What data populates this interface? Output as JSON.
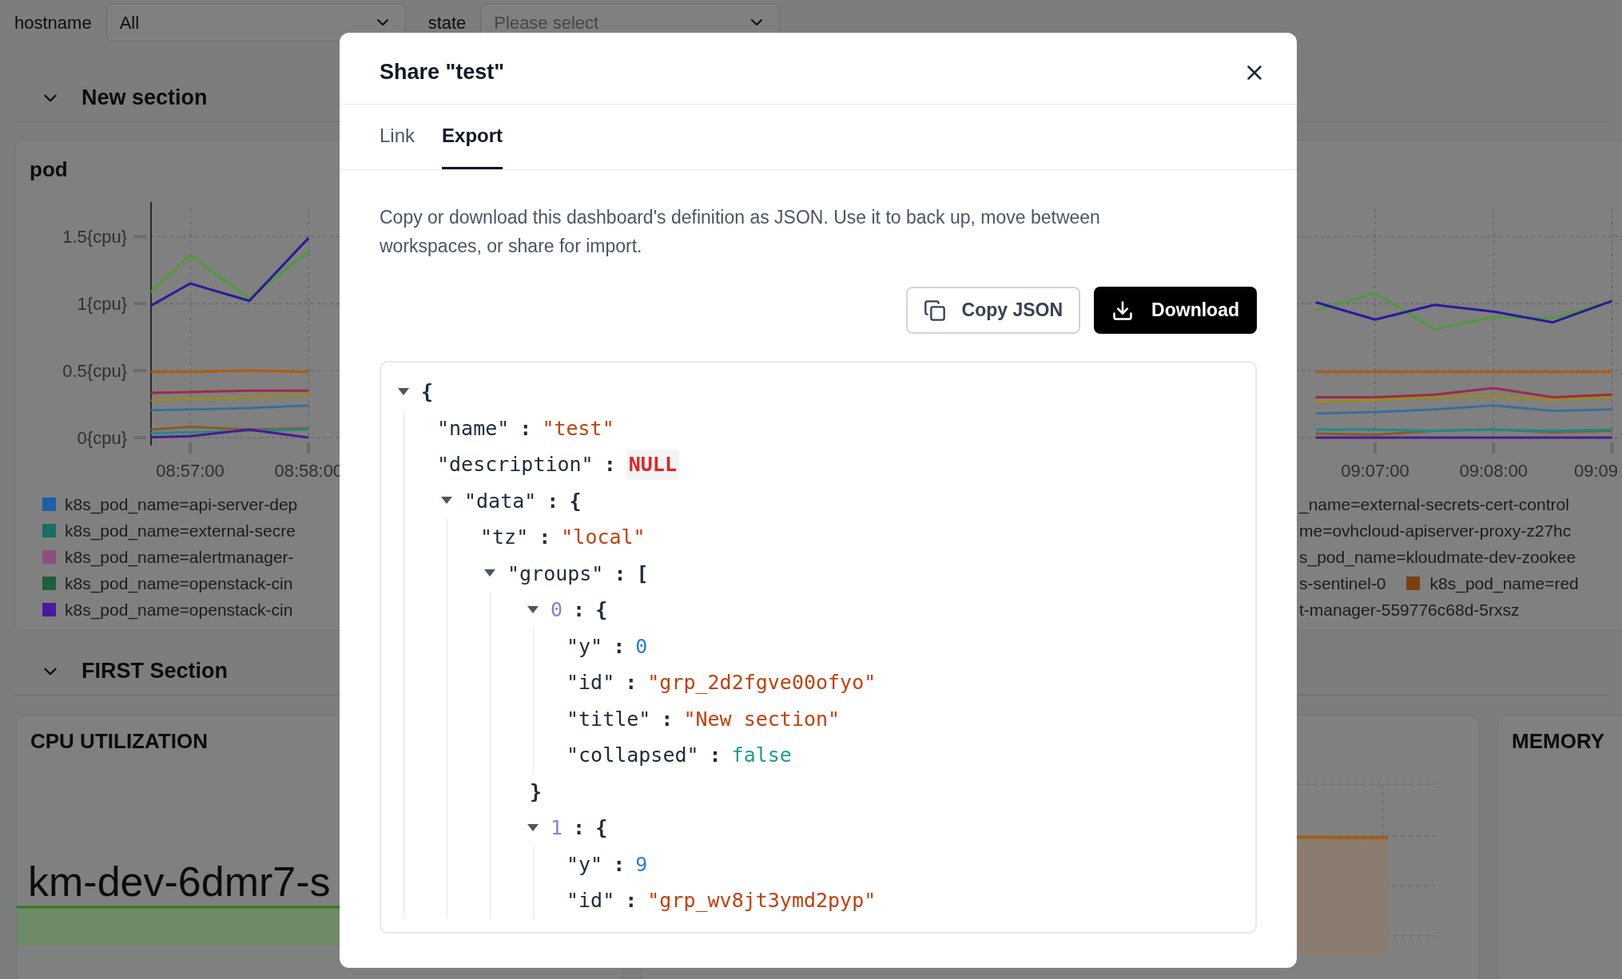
{
  "filters": [
    {
      "label": "hostname",
      "value": "All"
    },
    {
      "label": "state",
      "placeholder": "Please select"
    }
  ],
  "sections": [
    {
      "title": "New section",
      "expanded": true,
      "panels": [
        {
          "kind": "timeseries",
          "title": "pod",
          "chart_data": {
            "type": "line",
            "grid": true,
            "ylim": [
              0,
              1.71
            ],
            "categories": [
              null,
              "08:57:00",
              null,
              "08:58:00",
              null,
              null,
              null,
              null,
              null,
              null,
              null,
              null,
              null,
              null,
              null,
              null,
              null,
              null,
              null,
              null,
              null,
              "09:07:00",
              null,
              "09:08:00",
              null,
              "09:09"
            ],
            "yticks": [
              {
                "value": 0,
                "label": "0{cpu}"
              },
              {
                "value": 0.5,
                "label": "0.5{cpu}"
              },
              {
                "value": 1,
                "label": "1{cpu}"
              },
              {
                "value": 1.5,
                "label": "1.5{cpu}"
              }
            ],
            "series": [
              {
                "color": "#4f9a3b",
                "values": [
                  0.95,
                  1.36,
                  1.04,
                  1.39,
                  null,
                  null,
                  null,
                  null,
                  null,
                  null,
                  null,
                  null,
                  null,
                  null,
                  null,
                  null,
                  null,
                  null,
                  null,
                  null,
                  0.95,
                  1.08,
                  0.81,
                  0.9,
                  0.89,
                  1.02
                ]
              },
              {
                "color": "#2b1a9a",
                "values": [
                  0.9,
                  1.15,
                  1.02,
                  1.49,
                  null,
                  null,
                  null,
                  null,
                  null,
                  null,
                  null,
                  null,
                  null,
                  null,
                  null,
                  null,
                  null,
                  null,
                  null,
                  null,
                  1.01,
                  0.88,
                  0.99,
                  0.94,
                  0.86,
                  1.02
                ]
              },
              {
                "color": "#b05a10",
                "values": [
                  0.49,
                  0.49,
                  0.5,
                  0.49,
                  null,
                  null,
                  null,
                  null,
                  null,
                  null,
                  null,
                  null,
                  null,
                  null,
                  null,
                  null,
                  null,
                  null,
                  null,
                  null,
                  0.49,
                  0.49,
                  0.49,
                  0.49,
                  0.49,
                  0.49
                ]
              },
              {
                "color": "#a02a48",
                "values": [
                  0.33,
                  0.34,
                  0.35,
                  0.35,
                  null,
                  null,
                  null,
                  null,
                  null,
                  null,
                  null,
                  null,
                  null,
                  null,
                  null,
                  null,
                  null,
                  null,
                  null,
                  null,
                  0.3,
                  0.3,
                  0.32,
                  0.37,
                  0.3,
                  0.32
                ]
              },
              {
                "color": "#9a8a20",
                "values": [
                  0.27,
                  0.29,
                  0.3,
                  0.32,
                  null,
                  null,
                  null,
                  null,
                  null,
                  null,
                  null,
                  null,
                  null,
                  null,
                  null,
                  null,
                  null,
                  null,
                  null,
                  null,
                  0.27,
                  0.28,
                  0.3,
                  0.31,
                  0.28,
                  0.3
                ]
              },
              {
                "color": "#3a6e9a",
                "values": [
                  0.2,
                  0.21,
                  0.22,
                  0.24,
                  null,
                  null,
                  null,
                  null,
                  null,
                  null,
                  null,
                  null,
                  null,
                  null,
                  null,
                  null,
                  null,
                  null,
                  null,
                  null,
                  0.18,
                  0.19,
                  0.21,
                  0.24,
                  0.2,
                  0.21
                ]
              },
              {
                "color": "#8a5a28",
                "values": [
                  0.05,
                  0.08,
                  0.06,
                  0.07,
                  null,
                  null,
                  null,
                  null,
                  null,
                  null,
                  null,
                  null,
                  null,
                  null,
                  null,
                  null,
                  null,
                  null,
                  null,
                  null,
                  0.03,
                  0.02,
                  0.05,
                  0.06,
                  0.04,
                  0.05
                ]
              },
              {
                "color": "#208a8a",
                "values": [
                  0.03,
                  0.04,
                  0.05,
                  0.06,
                  null,
                  null,
                  null,
                  null,
                  null,
                  null,
                  null,
                  null,
                  null,
                  null,
                  null,
                  null,
                  null,
                  null,
                  null,
                  null,
                  0.06,
                  0.06,
                  0.05,
                  0.06,
                  0.05,
                  0.06
                ]
              },
              {
                "color": "#4a1a90",
                "values": [
                  0,
                  0.01,
                  0.06,
                  0,
                  null,
                  null,
                  null,
                  null,
                  null,
                  null,
                  null,
                  null,
                  null,
                  null,
                  null,
                  null,
                  null,
                  null,
                  null,
                  null,
                  0,
                  0,
                  0,
                  0,
                  0,
                  0
                ]
              }
            ]
          },
          "legend_left": [
            {
              "color": "#1e5fa8",
              "text": "k8s_pod_name=api-server-dep"
            },
            {
              "color": "#1a6e62",
              "text": "k8s_pod_name=external-secre"
            },
            {
              "color": "#8c4f7e",
              "text": "k8s_pod_name=alertmanager-"
            },
            {
              "color": "#1e5e3a",
              "text": "k8s_pod_name=openstack-cin"
            },
            {
              "color": "#4a1a9a",
              "text": "k8s_pod_name=openstack-cin"
            }
          ],
          "legend_right": [
            {
              "items": [
                {
                  "text": "_name=external-secrets-cert-control"
                }
              ]
            },
            {
              "items": [
                {
                  "text": "me=ovhcloud-apiserver-proxy-z27hc"
                }
              ]
            },
            {
              "items": [
                {
                  "text": "s_pod_name=kloudmate-dev-zookee"
                }
              ]
            },
            {
              "items": [
                {
                  "text": "s-sentinel-0"
                },
                {
                  "color": "#7a4010",
                  "text": "k8s_pod_name=red"
                }
              ]
            },
            {
              "items": [
                {
                  "text": "t-manager-559776c68d-5rxsz"
                }
              ]
            }
          ]
        }
      ]
    },
    {
      "title": "FIRST Section",
      "expanded": true,
      "panels": [
        {
          "kind": "stat",
          "title": "CPU UTILIZATION",
          "value": "km-dev-6dmr7-s"
        },
        {
          "kind": "graph"
        },
        {
          "kind": "stat",
          "title": "MEMORY"
        }
      ]
    }
  ],
  "dialog": {
    "title": "Share \"test\"",
    "tabs": [
      {
        "label": "Link",
        "selected": false
      },
      {
        "label": "Export",
        "selected": true
      }
    ],
    "description": "Copy or download this dashboard's definition as JSON. Use it to back up, move between workspaces, or share for import.",
    "buttons": [
      {
        "kind": "secondary",
        "label": "Copy JSON"
      },
      {
        "kind": "primary",
        "label": "Download"
      }
    ],
    "json_tree": {
      "kind": "object",
      "expanded": true,
      "open": "{",
      "children": [
        {
          "key": "\"name\"",
          "sep": ":",
          "kind": "string",
          "value": "\"test\""
        },
        {
          "key": "\"description\"",
          "sep": ":",
          "kind": "null",
          "value": "NULL"
        },
        {
          "key": "\"data\"",
          "sep": ":",
          "kind": "object",
          "expanded": true,
          "open": "{",
          "children": [
            {
              "key": "\"tz\"",
              "sep": ":",
              "kind": "string",
              "value": "\"local\""
            },
            {
              "key": "\"groups\"",
              "sep": ":",
              "kind": "array",
              "expanded": true,
              "open": "[",
              "children": [
                {
                  "key": "0",
                  "sep": ":",
                  "kind": "object",
                  "expanded": true,
                  "open": "{",
                  "close": "}",
                  "children": [
                    {
                      "key": "\"y\"",
                      "sep": ":",
                      "kind": "number",
                      "value": "0"
                    },
                    {
                      "key": "\"id\"",
                      "sep": ":",
                      "kind": "string",
                      "value": "\"grp_2d2fgve00ofyo\""
                    },
                    {
                      "key": "\"title\"",
                      "sep": ":",
                      "kind": "string",
                      "value": "\"New section\""
                    },
                    {
                      "key": "\"collapsed\"",
                      "sep": ":",
                      "kind": "boolean",
                      "value": "false"
                    }
                  ]
                },
                {
                  "key": "1",
                  "sep": ":",
                  "kind": "object",
                  "expanded": true,
                  "open": "{",
                  "children": [
                    {
                      "key": "\"y\"",
                      "sep": ":",
                      "kind": "number",
                      "value": "9"
                    },
                    {
                      "key": "\"id\"",
                      "sep": ":",
                      "kind": "string",
                      "value": "\"grp_wv8jt3ymd2pyp\""
                    }
                  ]
                }
              ]
            }
          ]
        }
      ]
    }
  }
}
